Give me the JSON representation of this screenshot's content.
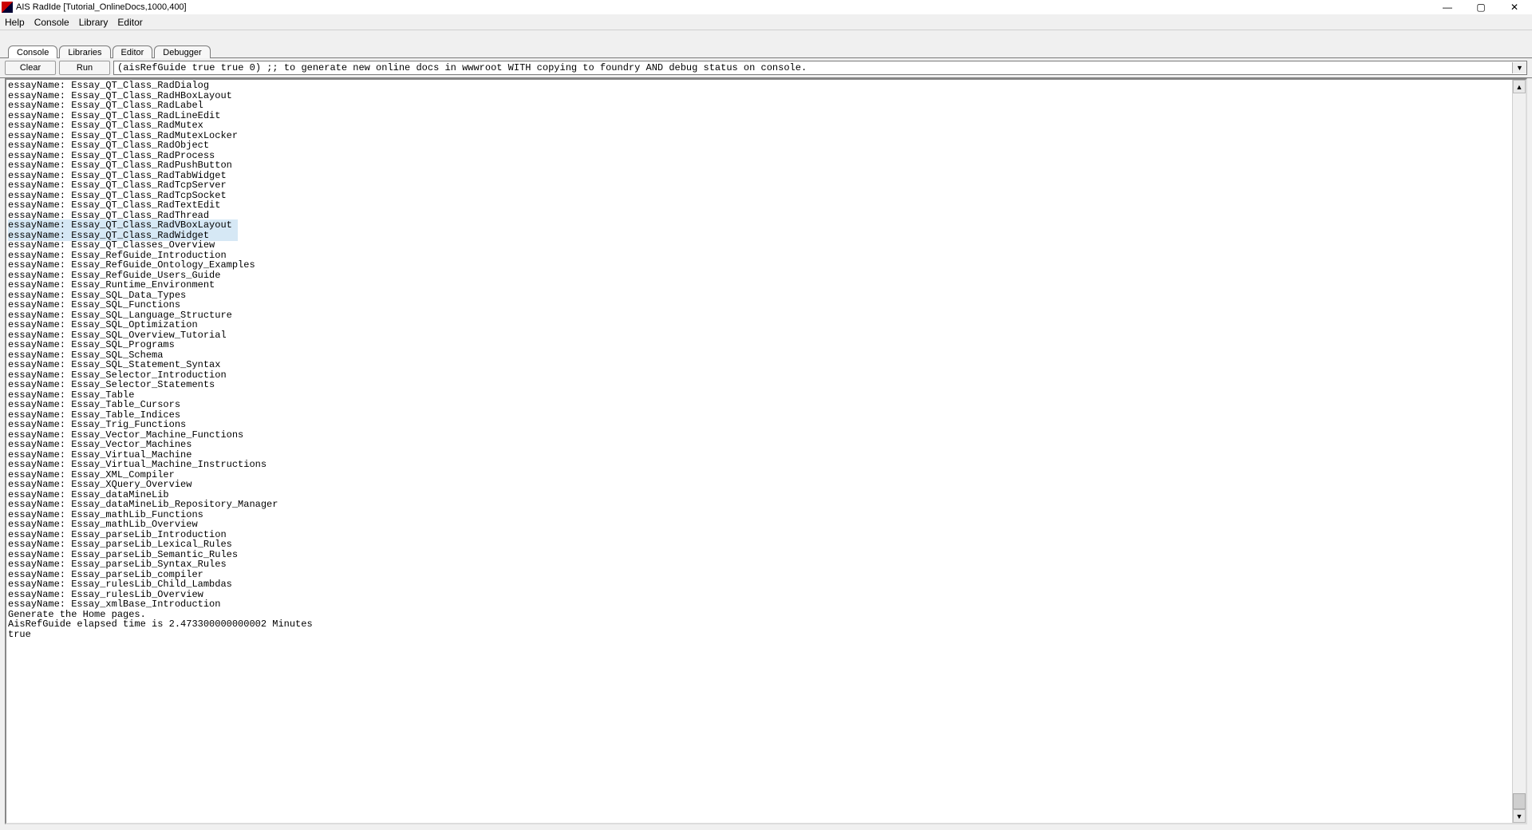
{
  "window": {
    "title": "AIS RadIde [Tutorial_OnlineDocs,1000,400]"
  },
  "menu": {
    "items": [
      "Help",
      "Console",
      "Library",
      "Editor"
    ]
  },
  "tabs": {
    "items": [
      "Console",
      "Libraries",
      "Editor",
      "Debugger"
    ],
    "active_index": 0
  },
  "toolbar": {
    "clear_label": "Clear",
    "run_label": "Run",
    "command_value": "(aisRefGuide true true 0) ;; to generate new online docs in wwwroot WITH copying to foundry AND debug status on console."
  },
  "console_output": {
    "label": "essayName:",
    "essays": [
      "Essay_QT_Class_RadDialog",
      "Essay_QT_Class_RadHBoxLayout",
      "Essay_QT_Class_RadLabel",
      "Essay_QT_Class_RadLineEdit",
      "Essay_QT_Class_RadMutex",
      "Essay_QT_Class_RadMutexLocker",
      "Essay_QT_Class_RadObject",
      "Essay_QT_Class_RadProcess",
      "Essay_QT_Class_RadPushButton",
      "Essay_QT_Class_RadTabWidget",
      "Essay_QT_Class_RadTcpServer",
      "Essay_QT_Class_RadTcpSocket",
      "Essay_QT_Class_RadTextEdit",
      "Essay_QT_Class_RadThread",
      "Essay_QT_Class_RadVBoxLayout",
      "Essay_QT_Class_RadWidget",
      "Essay_QT_Classes_Overview",
      "Essay_RefGuide_Introduction",
      "Essay_RefGuide_Ontology_Examples",
      "Essay_RefGuide_Users_Guide",
      "Essay_Runtime_Environment",
      "Essay_SQL_Data_Types",
      "Essay_SQL_Functions",
      "Essay_SQL_Language_Structure",
      "Essay_SQL_Optimization",
      "Essay_SQL_Overview_Tutorial",
      "Essay_SQL_Programs",
      "Essay_SQL_Schema",
      "Essay_SQL_Statement_Syntax",
      "Essay_Selector_Introduction",
      "Essay_Selector_Statements",
      "Essay_Table",
      "Essay_Table_Cursors",
      "Essay_Table_Indices",
      "Essay_Trig_Functions",
      "Essay_Vector_Machine_Functions",
      "Essay_Vector_Machines",
      "Essay_Virtual_Machine",
      "Essay_Virtual_Machine_Instructions",
      "Essay_XML_Compiler",
      "Essay_XQuery_Overview",
      "Essay_dataMineLib",
      "Essay_dataMineLib_Repository_Manager",
      "Essay_mathLib_Functions",
      "Essay_mathLib_Overview",
      "Essay_parseLib_Introduction",
      "Essay_parseLib_Lexical_Rules",
      "Essay_parseLib_Semantic_Rules",
      "Essay_parseLib_Syntax_Rules",
      "Essay_parseLib_compiler",
      "Essay_rulesLib_Child_Lambdas",
      "Essay_rulesLib_Overview",
      "Essay_xmlBase_Introduction"
    ],
    "tail": [
      "Generate the Home pages.",
      "AisRefGuide elapsed time is 2.473300000000002 Minutes",
      "true"
    ],
    "selected_indices": [
      14,
      15
    ]
  }
}
